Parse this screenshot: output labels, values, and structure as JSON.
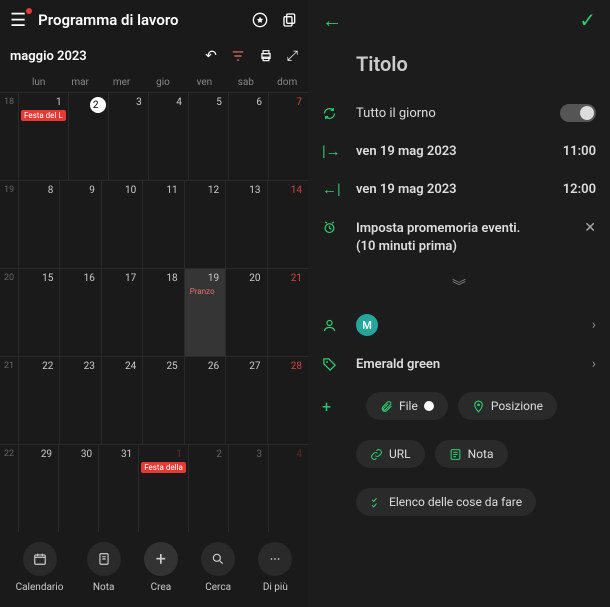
{
  "header": {
    "title": "Programma di lavoro"
  },
  "calendar": {
    "month_label": "maggio 2023",
    "weekdays": [
      "lun",
      "mar",
      "mer",
      "gio",
      "ven",
      "sab",
      "dom"
    ],
    "weeks": [
      {
        "num": "18",
        "days": [
          {
            "n": "1",
            "ev": "Festa del L",
            "cls": "hol"
          },
          {
            "n": "2",
            "today": true
          },
          {
            "n": "3"
          },
          {
            "n": "4"
          },
          {
            "n": "5"
          },
          {
            "n": "6"
          },
          {
            "n": "7",
            "sun": true
          }
        ]
      },
      {
        "num": "19",
        "days": [
          {
            "n": "8"
          },
          {
            "n": "9"
          },
          {
            "n": "10"
          },
          {
            "n": "11"
          },
          {
            "n": "12"
          },
          {
            "n": "13"
          },
          {
            "n": "14",
            "sun": true
          }
        ]
      },
      {
        "num": "20",
        "days": [
          {
            "n": "15"
          },
          {
            "n": "16"
          },
          {
            "n": "17"
          },
          {
            "n": "18"
          },
          {
            "n": "19",
            "sel": true,
            "ev": "Pranzo",
            "evcls": "pranzo"
          },
          {
            "n": "20"
          },
          {
            "n": "21",
            "sun": true
          }
        ]
      },
      {
        "num": "21",
        "days": [
          {
            "n": "22"
          },
          {
            "n": "23"
          },
          {
            "n": "24"
          },
          {
            "n": "25"
          },
          {
            "n": "26"
          },
          {
            "n": "27"
          },
          {
            "n": "28",
            "sun": true
          }
        ]
      },
      {
        "num": "22",
        "days": [
          {
            "n": "29"
          },
          {
            "n": "30"
          },
          {
            "n": "31"
          },
          {
            "n": "1",
            "dim": true,
            "sun": true,
            "ev": "Festa della",
            "cls": "hol"
          },
          {
            "n": "2",
            "dim": true
          },
          {
            "n": "3",
            "dim": true
          },
          {
            "n": "4",
            "dim": true,
            "sun": true
          }
        ]
      }
    ]
  },
  "bottom_nav": [
    {
      "label": "Calendario",
      "icon": "cal"
    },
    {
      "label": "Nota",
      "icon": "note"
    },
    {
      "label": "Crea",
      "icon": "plus"
    },
    {
      "label": "Cerca",
      "icon": "search"
    },
    {
      "label": "Di più",
      "icon": "more"
    }
  ],
  "event": {
    "title": "Titolo",
    "all_day_label": "Tutto il giorno",
    "start_date": "ven 19 mag 2023",
    "start_time": "11:00",
    "end_date": "ven 19 mag 2023",
    "end_time": "12:00",
    "reminder_line1": "Imposta promemoria eventi.",
    "reminder_line2": "(10 minuti prima)",
    "avatar_letter": "M",
    "color_label": "Emerald green",
    "chips": {
      "file": "File",
      "position": "Posizione",
      "url": "URL",
      "note": "Nota",
      "todo": "Elenco delle cose da fare"
    }
  }
}
